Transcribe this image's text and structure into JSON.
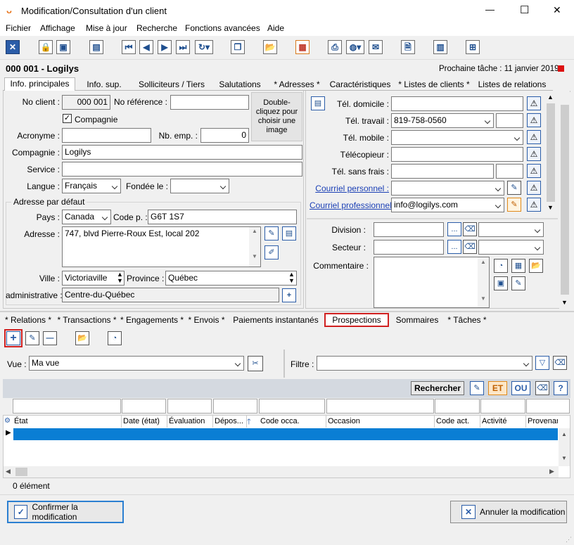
{
  "window": {
    "title": "Modification/Consultation d'un client",
    "minimize": "—",
    "maximize": "☐",
    "close": "✕"
  },
  "menu": [
    "Fichier",
    "Affichage",
    "Mise à jour",
    "Recherche",
    "Fonctions avancées",
    "Aide"
  ],
  "header": {
    "client": "000 001 - Logilys",
    "next_task": "Prochaine tâche : 11 janvier 2019"
  },
  "tabs": [
    "Info. principales",
    "Info. sup.",
    "Solliciteurs / Tiers",
    "Salutations",
    "* Adresses *",
    "Caractéristiques",
    "* Listes de clients *",
    "Listes de relations"
  ],
  "form": {
    "no_client_label": "No client :",
    "no_client": "000 001",
    "no_ref_label": "No référence :",
    "no_ref": "",
    "photo_text": "Double-cliquez pour choisir une image",
    "compagnie_check": "Compagnie",
    "acronyme_label": "Acronyme :",
    "acronyme": "",
    "nb_emp_label": "Nb. emp. :",
    "nb_emp": "0",
    "compagnie_label": "Compagnie :",
    "compagnie": "Logilys",
    "service_label": "Service :",
    "service": "",
    "langue_label": "Langue :",
    "langue": "Français",
    "fondee_label": "Fondée le :",
    "fondee": "",
    "adresse_group": "Adresse par défaut",
    "pays_label": "Pays :",
    "pays": "Canada",
    "code_p_label": "Code p. :",
    "code_p": "G6T 1S7",
    "adresse_label": "Adresse :",
    "adresse": "747, blvd Pierre-Roux Est, local 202",
    "ville_label": "Ville :",
    "ville": "Victoriaville",
    "province_label": "Province :",
    "province": "Québec",
    "admin_label": "administrative :",
    "admin": "Centre-du-Québec"
  },
  "contact": {
    "tel_domicile_label": "Tél. domicile :",
    "tel_domicile": "",
    "tel_travail_label": "Tél. travail :",
    "tel_travail": "819-758-0560",
    "tel_mobile_label": "Tél. mobile :",
    "tel_mobile": "",
    "telecopieur_label": "Télécopieur :",
    "telecopieur": "",
    "tel_sans_frais_label": "Tél. sans frais :",
    "tel_sans_frais": "",
    "courriel_perso_label": "Courriel personnel :",
    "courriel_perso": "",
    "courriel_pro_label": "Courriel professionnel :",
    "courriel_pro": "info@logilys.com"
  },
  "org": {
    "division_label": "Division :",
    "secteur_label": "Secteur :",
    "commentaire_label": "Commentaire :",
    "dots": "..."
  },
  "bottom_tabs": [
    "* Relations *",
    "* Transactions *",
    "* Engagements *",
    "* Envois *",
    "Paiements instantanés",
    "Prospections",
    "Sommaires",
    "* Tâches *"
  ],
  "view": {
    "vue_label": "Vue :",
    "vue": "Ma vue",
    "filtre_label": "Filtre :",
    "filtre": ""
  },
  "search": {
    "rechercher": "Rechercher",
    "et": "ET",
    "ou": "OU",
    "help": "?"
  },
  "grid": {
    "columns": [
      "État",
      "Date (état)",
      "Évaluation",
      "Dépos...",
      "Code occa.",
      "Occasion",
      "Code act.",
      "Activité",
      "Provenar"
    ],
    "count": "0 élément"
  },
  "buttons": {
    "confirm": "Confirmer la modification",
    "cancel": "Annuler la modification"
  }
}
